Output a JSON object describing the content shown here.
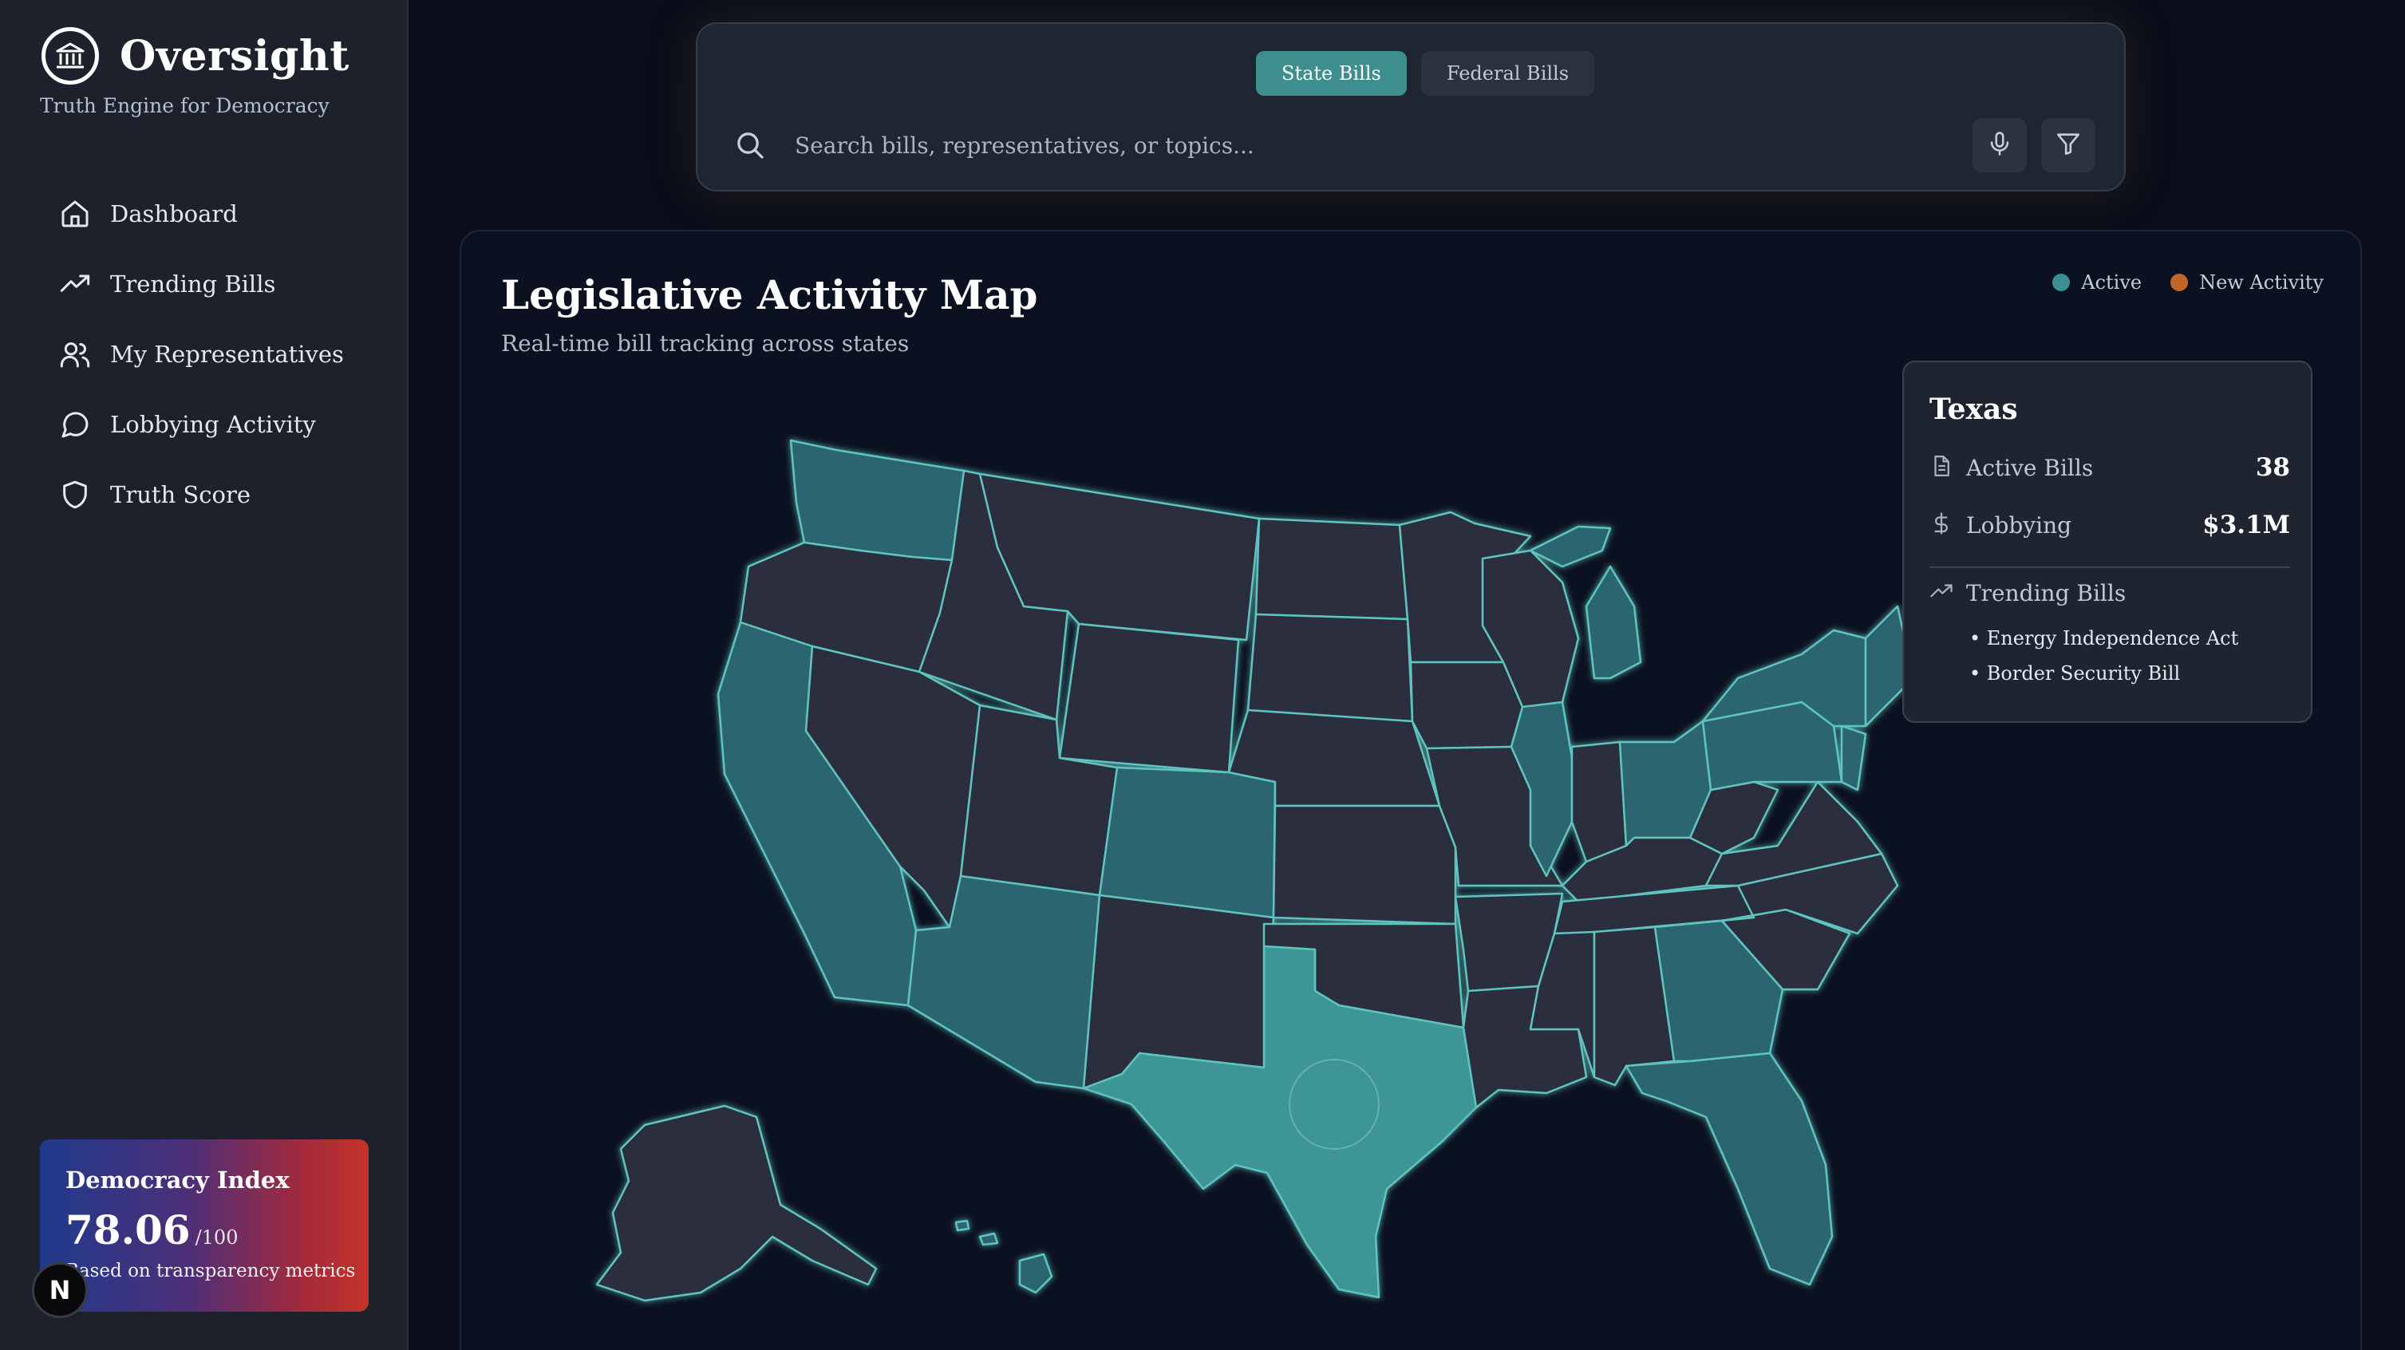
{
  "brand": {
    "name": "Oversight",
    "tagline": "Truth Engine for Democracy"
  },
  "nav": {
    "items": [
      {
        "label": "Dashboard",
        "icon": "home-icon"
      },
      {
        "label": "Trending Bills",
        "icon": "trending-up-icon"
      },
      {
        "label": "My Representatives",
        "icon": "users-icon"
      },
      {
        "label": "Lobbying Activity",
        "icon": "chat-bubble-icon"
      },
      {
        "label": "Truth Score",
        "icon": "shield-icon"
      }
    ]
  },
  "democracy_index": {
    "title": "Democracy Index",
    "value": "78.06",
    "max": "/100",
    "note": "Based on transparency metrics"
  },
  "n_badge": "N",
  "search": {
    "tabs": [
      {
        "label": "State Bills",
        "active": true
      },
      {
        "label": "Federal Bills",
        "active": false
      }
    ],
    "placeholder": "Search bills, representatives, or topics..."
  },
  "map": {
    "title": "Legislative Activity Map",
    "subtitle": "Real-time bill tracking across states",
    "legend": [
      {
        "label": "Active",
        "color": "#3a8f92"
      },
      {
        "label": "New Activity",
        "color": "#c0662a"
      }
    ],
    "colors": {
      "active": "#2a6570",
      "inactive": "#2b2f3d",
      "highlight": "#3e9595",
      "border": "#5fc4c0"
    }
  },
  "tooltip": {
    "state": "Texas",
    "active_bills_label": "Active Bills",
    "active_bills_value": "38",
    "lobbying_label": "Lobbying",
    "lobbying_value": "$3.1M",
    "trending_label": "Trending Bills",
    "trending": [
      "• Energy Independence Act",
      "• Border Security Bill"
    ]
  }
}
